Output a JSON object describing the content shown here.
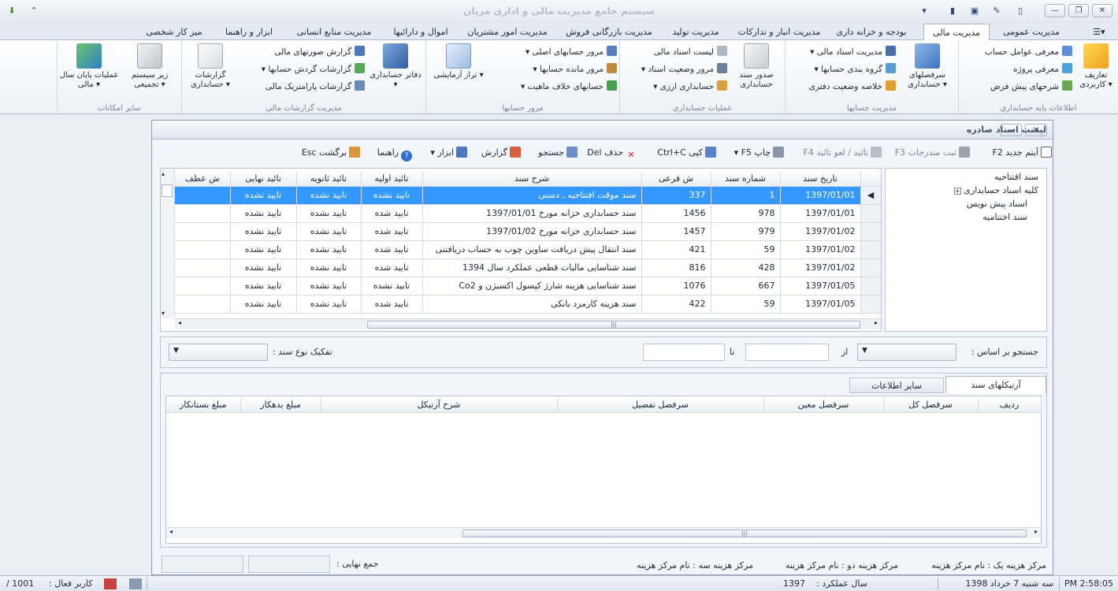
{
  "app": {
    "title": "سیستم جامع مدیریت مالی و اداری مریان"
  },
  "tabs": [
    "مدیریت عمومی",
    "مدیریت مالی",
    "بودجه و خزانه داری",
    "مدیریت انبار و تدارکات",
    "مدیریت تولید",
    "مدیریت بازرگانی فروش",
    "مدیریت امور مشتریان",
    "اموال و دارائیها",
    "مدیریت منابع انسانی",
    "ابزار و راهنما",
    "میز کار شخصی"
  ],
  "ribbon": {
    "g1": {
      "title": "اطلاعات پایه حسابداری",
      "big": "تعاریف کاربردی",
      "items": [
        "معرفی عوامل حساب",
        "معرفی پروژه",
        "شرحهای پیش فرض"
      ]
    },
    "g2": {
      "title": "مدیریت حسابها",
      "big": "سرفصلهای حسابداری",
      "items": [
        "مدیریت اسناد مالی",
        "گروه بندی حسابها",
        "خلاصه وضعیت دفتری"
      ]
    },
    "g3": {
      "title": "عملیات حسابداری",
      "big": "صدور سند حسابداری",
      "items": [
        "لیست اسناد مالی",
        "مرور وضعیت اسناد",
        "حسابداری ارزی"
      ]
    },
    "g4": {
      "title": "مرور حسابها",
      "big": "تراز آزمایشی",
      "items": [
        "مرور حسابهای اصلی",
        "مرور مانده حسابها",
        "حسابهای خلاف ماهیت"
      ]
    },
    "g5": {
      "title": "مدیریت گزارشات مالی",
      "big1": "دفاتر حسابداری",
      "big2": "گزارشات حسابداری",
      "items": [
        "گزارش صورتهای مالی",
        "گزارشات گردش حسابها",
        "گزارشات پارامتریک مالی"
      ]
    },
    "g6": {
      "title": "سایر امکانات",
      "big1": "زیر سیستم تجمیعی",
      "big2": "عملیات پایان سال مالی"
    }
  },
  "window": {
    "title": "لیست اسناد صادره"
  },
  "toolbar": {
    "new": "آیتم جدید F2",
    "post": "ثبت مندرجات F3",
    "approve": "تائید / لغو تائید F4",
    "print": "چاپ F5",
    "copy": "کپی Ctrl+C",
    "delete": "حذف Del",
    "search": "جستجو",
    "report": "گزارش",
    "tools": "ابزار",
    "help": "راهنما",
    "back": "برگشت Esc"
  },
  "tree": {
    "items": [
      "سند افتتاحیه",
      "کلیه اسناد حسابداری",
      "اسناد پیش نویس",
      "سند اختتامیه"
    ]
  },
  "grid": {
    "columns": [
      "تاریخ سند",
      "شماره سند",
      "ش فرعی",
      "شرح سند",
      "تائید اولیه",
      "تائید ثانویه",
      "تائید نهایی",
      "ش عطف"
    ],
    "rows": [
      [
        "1397/01/01",
        "1",
        "337",
        "سند موقت افتتاحیه ـ دستی",
        "تایید نشده",
        "تایید نشده",
        "تایید نشده",
        ""
      ],
      [
        "1397/01/01",
        "978",
        "1456",
        "سند حسابداری خزانه مورخ 1397/01/01",
        "تایید شده",
        "تایید نشده",
        "تایید نشده",
        ""
      ],
      [
        "1397/01/02",
        "979",
        "1457",
        "سند حسابداری خزانه مورخ 1397/01/02",
        "تایید شده",
        "تایید نشده",
        "تایید نشده",
        ""
      ],
      [
        "1397/01/02",
        "59",
        "421",
        "سند انتقال پیش دریافت ساوین چوب به حساب دریافتنی",
        "تایید شده",
        "تایید نشده",
        "تایید نشده",
        ""
      ],
      [
        "1397/01/02",
        "428",
        "816",
        "سند شناسایی مالیات قطعی عملکرد سال 1394",
        "تایید شده",
        "تایید نشده",
        "تایید نشده",
        ""
      ],
      [
        "1397/01/05",
        "667",
        "1076",
        "سند شناسایی هزینه شارژ کپسول اکسیژن و Co2",
        "تایید نشده",
        "تایید نشده",
        "تایید نشده",
        ""
      ],
      [
        "1397/01/05",
        "59",
        "422",
        "سند هزینه کارمزد بانکی",
        "تایید شده",
        "تایید نشده",
        "تایید نشده",
        ""
      ]
    ]
  },
  "filter": {
    "search_label": "جستجو بر اساس :",
    "from": "از",
    "to": "تا",
    "doc_type_label": "تفکیک نوع سند :"
  },
  "detail_tabs": [
    "آرتیکلهای سند",
    "سایر اطلاعات"
  ],
  "articles": {
    "columns": [
      "ردیف",
      "سرفصل کل",
      "سرفصل معین",
      "سرفصل تفصیل",
      "شرح آرتیکل",
      "مبلغ بدهکار",
      "مبلغ بستانکار"
    ]
  },
  "cost": {
    "c1": "مرکز هزینه یک : نام مرکز هزینه",
    "c2": "مرکز هزینه دو : نام مرکز هزینه",
    "c3": "مرکز هزینه سه : نام مرکز هزینه",
    "total": "جمع نهایی :"
  },
  "status": {
    "time": "PM 2:58:05",
    "date": "سه شنبه 7 خرداد 1398",
    "fiscal_label": "سال عملکرد :",
    "fiscal_value": "1397",
    "user_label": "کاربر فعال :",
    "user_value": "1001 / "
  }
}
